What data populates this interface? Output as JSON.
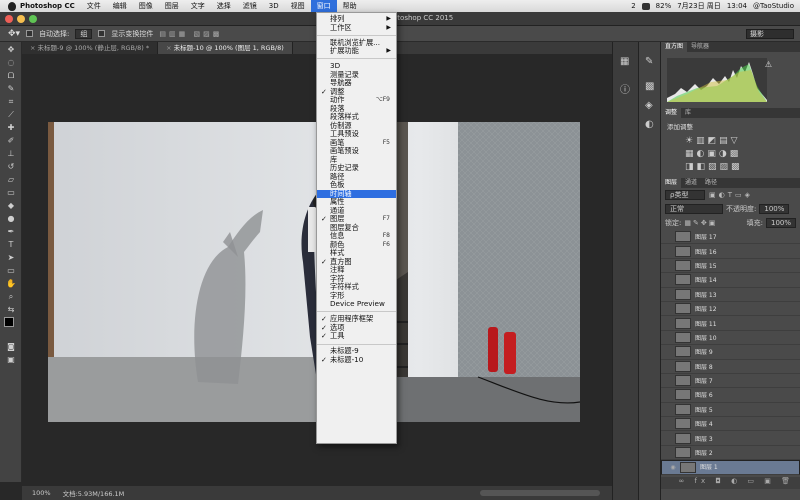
{
  "menubar": {
    "app": "Photoshop CC",
    "items": [
      "文件",
      "编辑",
      "图像",
      "图层",
      "文字",
      "选择",
      "滤镜",
      "3D",
      "视图",
      "窗口",
      "帮助"
    ],
    "active_index": 9,
    "status": {
      "badge": "2",
      "battery": "82%",
      "date": "7月23日 周日",
      "time": "13:04",
      "user": "@TaoStudio"
    }
  },
  "window_title": "Adobe Photoshop CC 2015",
  "options_bar": {
    "auto_select": "自动选择:",
    "auto_select_value": "组",
    "show_transform": "显示变换控件",
    "workspace": "摄影"
  },
  "doc_tabs": [
    {
      "label": "未标题-9 @ 100% (静止层, RGB/8) *"
    },
    {
      "label": "未标题-10 @ 100% (图层 1, RGB/8)"
    }
  ],
  "status_bar": {
    "zoom": "100%",
    "doc_info": "文档:5.93M/166.1M"
  },
  "window_menu": [
    {
      "label": "排列",
      "submenu": true
    },
    {
      "label": "工作区",
      "submenu": true
    },
    {
      "sep": true
    },
    {
      "label": "联机浏览扩展..."
    },
    {
      "label": "扩展功能",
      "submenu": true
    },
    {
      "sep": true
    },
    {
      "label": "3D"
    },
    {
      "label": "测量记录"
    },
    {
      "label": "导航器"
    },
    {
      "label": "调整",
      "checked": true
    },
    {
      "label": "动作",
      "shortcut": "⌥F9"
    },
    {
      "label": "段落"
    },
    {
      "label": "段落样式"
    },
    {
      "label": "仿制源"
    },
    {
      "label": "工具预设"
    },
    {
      "label": "画笔",
      "shortcut": "F5"
    },
    {
      "label": "画笔预设"
    },
    {
      "label": "库"
    },
    {
      "label": "历史记录"
    },
    {
      "label": "路径"
    },
    {
      "label": "色板"
    },
    {
      "label": "时间轴",
      "highlighted": true
    },
    {
      "label": "属性"
    },
    {
      "label": "通道"
    },
    {
      "label": "图层",
      "checked": true,
      "shortcut": "F7"
    },
    {
      "label": "图层复合"
    },
    {
      "label": "信息",
      "shortcut": "F8"
    },
    {
      "label": "颜色",
      "shortcut": "F6"
    },
    {
      "label": "样式"
    },
    {
      "label": "直方图",
      "checked": true
    },
    {
      "label": "注释"
    },
    {
      "label": "字符"
    },
    {
      "label": "字符样式"
    },
    {
      "label": "字形"
    },
    {
      "label": "Device Preview"
    },
    {
      "sep": true
    },
    {
      "label": "应用程序框架",
      "checked": true
    },
    {
      "label": "选项",
      "checked": true
    },
    {
      "label": "工具",
      "checked": true
    },
    {
      "sep": true
    },
    {
      "label": "未标题-9"
    },
    {
      "label": "未标题-10",
      "checked": true
    }
  ],
  "panels": {
    "histogram_tabs": [
      "直方图",
      "导航器"
    ],
    "adjust_tabs": [
      "调整",
      "库"
    ],
    "adjust_title": "添加调整",
    "layers_tabs": [
      "图层",
      "通道",
      "路径"
    ],
    "kind": "ρ类型",
    "blend": "正常",
    "opacity_label": "不透明度:",
    "opacity_value": "100%",
    "lock_label": "锁定:",
    "fill_label": "填充:",
    "fill_value": "100%",
    "layers": [
      "图层 17",
      "图层 16",
      "图层 15",
      "图层 14",
      "图层 13",
      "图层 12",
      "图层 11",
      "图层 10",
      "图层 9",
      "图层 8",
      "图层 7",
      "图层 6",
      "图层 5",
      "图层 4",
      "图层 3",
      "图层 2",
      "图层 1"
    ],
    "selected_layer": "图层 1"
  },
  "colors": {
    "menu_highlight": "#2e6ee0",
    "panel_bg": "#4a4a4a",
    "selected_layer": "#6a7a93"
  }
}
